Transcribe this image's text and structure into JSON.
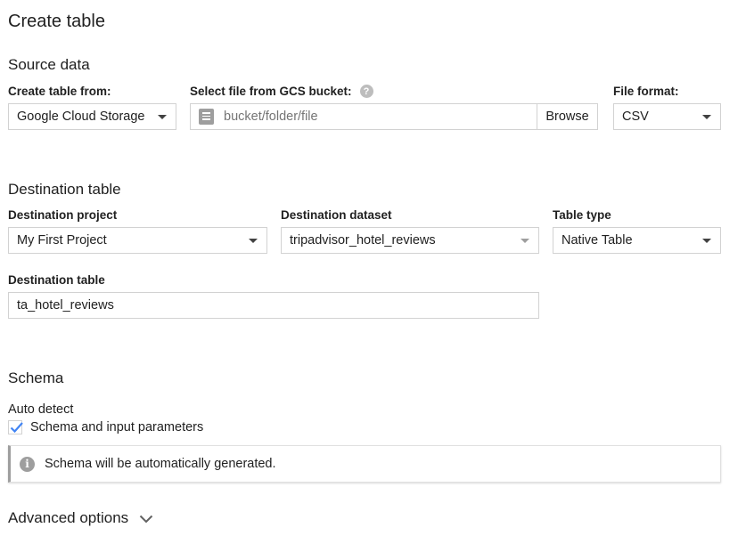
{
  "page": {
    "title": "Create table"
  },
  "source": {
    "section_title": "Source data",
    "create_from": {
      "label": "Create table from:",
      "value": "Google Cloud Storage"
    },
    "gcs_bucket": {
      "label": "Select file from GCS bucket:",
      "placeholder": "bucket/folder/file",
      "value": "",
      "browse_label": "Browse",
      "help_icon": "help-icon"
    },
    "file_format": {
      "label": "File format:",
      "value": "CSV"
    }
  },
  "destination": {
    "section_title": "Destination table",
    "project": {
      "label": "Destination project",
      "value": "My First Project"
    },
    "dataset": {
      "label": "Destination dataset",
      "value": "tripadvisor_hotel_reviews"
    },
    "table_type": {
      "label": "Table type",
      "value": "Native Table"
    },
    "table": {
      "label": "Destination table",
      "value": "ta_hotel_reviews"
    }
  },
  "schema": {
    "section_title": "Schema",
    "auto_detect_label": "Auto detect",
    "checkbox_label": "Schema and input parameters",
    "checkbox_checked": true,
    "info_text": "Schema will be automatically generated.",
    "info_icon": "info-icon"
  },
  "advanced": {
    "label": "Advanced options",
    "icon": "chevron-down-icon"
  },
  "colors": {
    "checkmark": "#4285f4",
    "border": "#d2d2d2",
    "text": "#212121",
    "placeholder": "#757575"
  }
}
